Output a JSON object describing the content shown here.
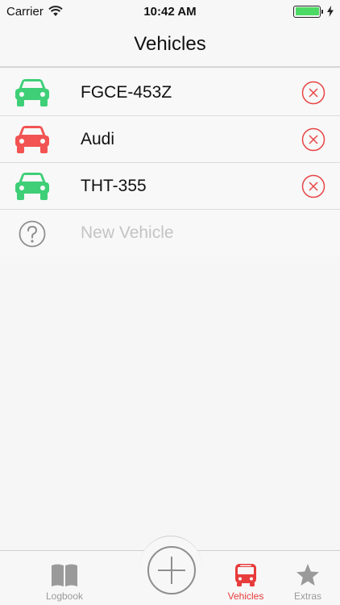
{
  "status_bar": {
    "carrier": "Carrier",
    "time": "10:42 AM"
  },
  "nav": {
    "title": "Vehicles"
  },
  "vehicles": [
    {
      "name": "FGCE-453Z",
      "color": "#3ecf77"
    },
    {
      "name": "Audi",
      "color": "#f25353"
    },
    {
      "name": "THT-355",
      "color": "#3ecf77"
    }
  ],
  "new_vehicle": {
    "placeholder": "New Vehicle"
  },
  "tabs": {
    "logbook": "Logbook",
    "vehicles": "Vehicles",
    "extras": "Extras"
  },
  "colors": {
    "accent": "#e83b3b",
    "delete": "#e84545",
    "inactive": "#9a9a9a",
    "battery": "#4cd964"
  },
  "icons": {
    "row_icon": "car-icon",
    "delete": "delete-circle-x-icon",
    "new": "question-circle-icon",
    "tab_logbook": "book-icon",
    "tab_add": "plus-circle-icon",
    "tab_vehicles": "bus-icon",
    "tab_extras": "star-icon"
  }
}
